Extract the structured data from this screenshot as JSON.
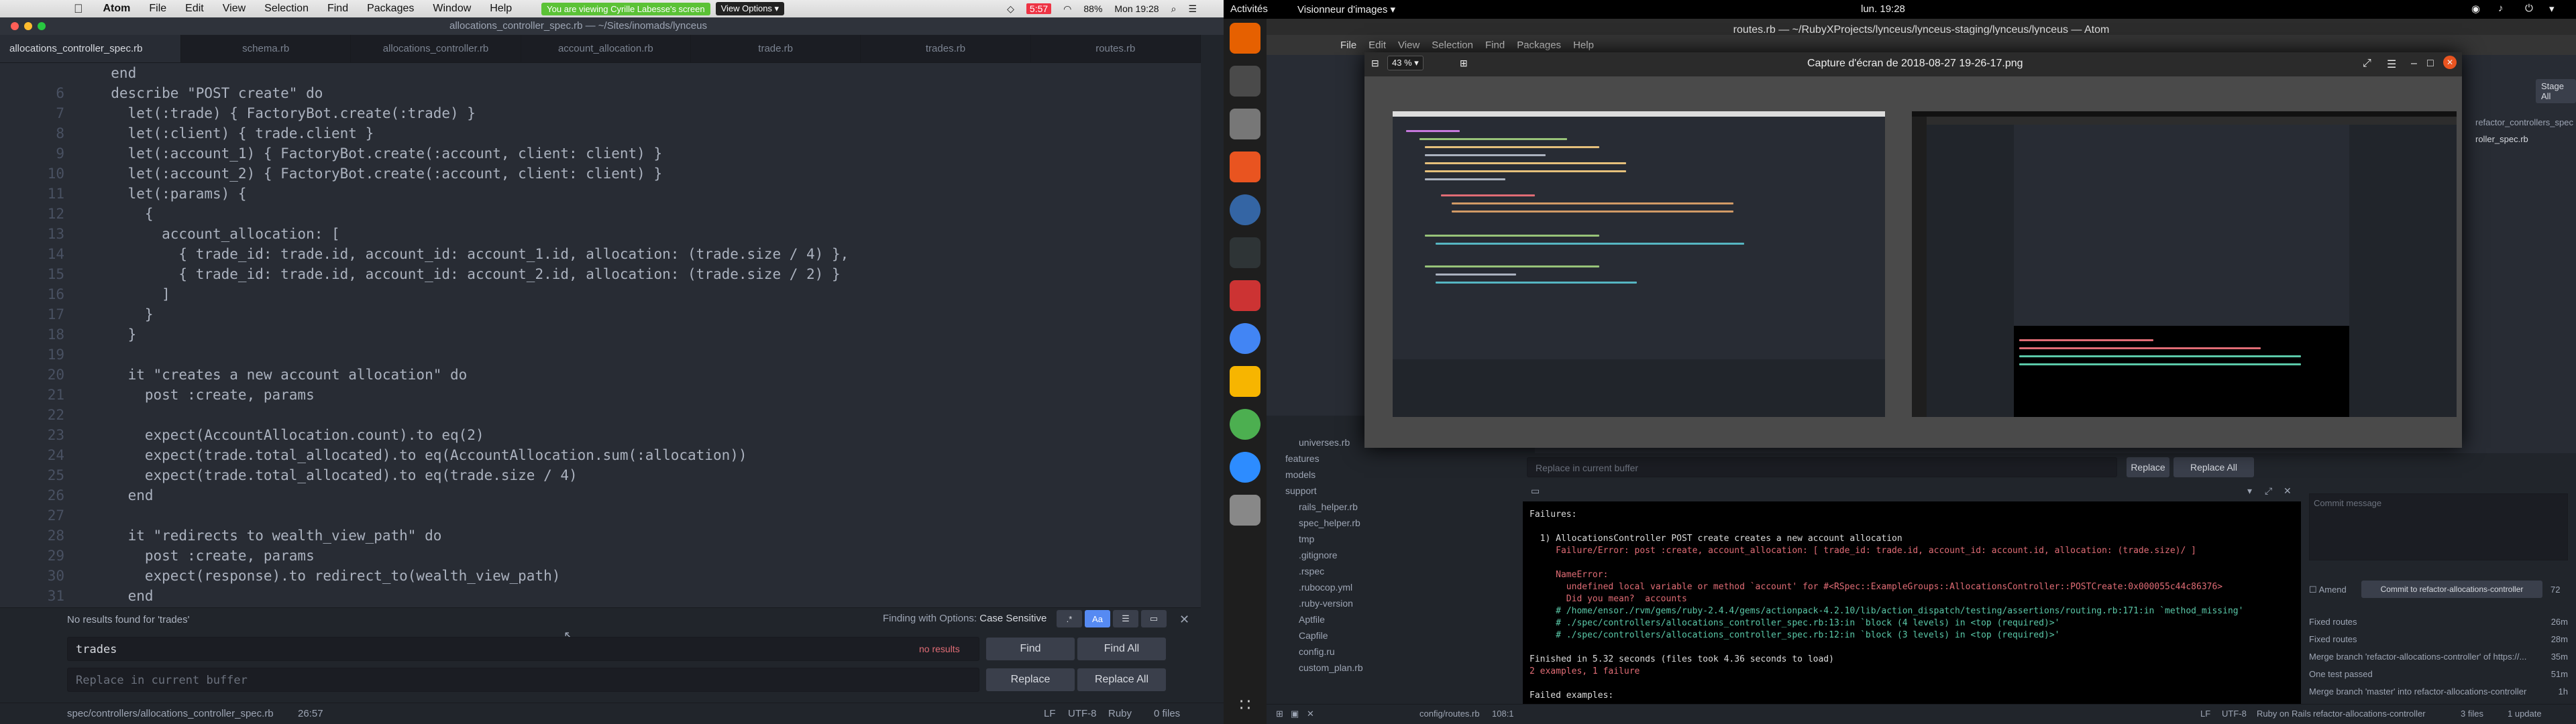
{
  "mac_menubar": {
    "apple_icon": "apple-icon",
    "items": [
      "Atom",
      "File",
      "Edit",
      "View",
      "Selection",
      "Find",
      "Packages",
      "Window",
      "Help"
    ],
    "share_notice": "You are viewing Cyrille Labesse's screen",
    "share_options": "View Options ▾",
    "window_title": "allocations_controller_spec.rb — ~/Sites/inomads/lynceus",
    "battery_time": "5:57",
    "battery_pct": "88%",
    "clock": "Mon 19:28"
  },
  "atom_left": {
    "tabs": [
      "allocations_controller_spec.rb",
      "schema.rb",
      "allocations_controller.rb",
      "account_allocation.rb",
      "trade.rb",
      "trades.rb",
      "routes.rb"
    ],
    "code_lines": [
      {
        "n": "",
        "t": "  end"
      },
      {
        "n": "6",
        "t": "  describe \"POST create\" do"
      },
      {
        "n": "7",
        "t": "    let(:trade) { FactoryBot.create(:trade) }"
      },
      {
        "n": "8",
        "t": "    let(:client) { trade.client }"
      },
      {
        "n": "9",
        "t": "    let(:account_1) { FactoryBot.create(:account, client: client) }"
      },
      {
        "n": "10",
        "t": "    let(:account_2) { FactoryBot.create(:account, client: client) }"
      },
      {
        "n": "11",
        "t": "    let(:params) {"
      },
      {
        "n": "12",
        "t": "      {"
      },
      {
        "n": "13",
        "t": "        account_allocation: ["
      },
      {
        "n": "14",
        "t": "          { trade_id: trade.id, account_id: account_1.id, allocation: (trade.size / 4) },"
      },
      {
        "n": "15",
        "t": "          { trade_id: trade.id, account_id: account_2.id, allocation: (trade.size / 2) }"
      },
      {
        "n": "16",
        "t": "        ]"
      },
      {
        "n": "17",
        "t": "      }"
      },
      {
        "n": "18",
        "t": "    }"
      },
      {
        "n": "19",
        "t": ""
      },
      {
        "n": "20",
        "t": "    it \"creates a new account allocation\" do"
      },
      {
        "n": "21",
        "t": "      post :create, params"
      },
      {
        "n": "22",
        "t": ""
      },
      {
        "n": "23",
        "t": "      expect(AccountAllocation.count).to eq(2)"
      },
      {
        "n": "24",
        "t": "      expect(trade.total_allocated).to eq(AccountAllocation.sum(:allocation))"
      },
      {
        "n": "25",
        "t": "      expect(trade.total_allocated).to eq(trade.size / 4)"
      },
      {
        "n": "26",
        "t": "    end"
      },
      {
        "n": "27",
        "t": ""
      },
      {
        "n": "28",
        "t": "    it \"redirects to wealth_view_path\" do"
      },
      {
        "n": "29",
        "t": "      post :create, params"
      },
      {
        "n": "30",
        "t": "      expect(response).to redirect_to(wealth_view_path)"
      },
      {
        "n": "31",
        "t": "    end"
      },
      {
        "n": "32",
        "t": "  end"
      }
    ],
    "find": {
      "status": "No results found for 'trades'",
      "options_label": "Finding with Options:",
      "options_value": "Case Sensitive",
      "option_buttons": [
        ".*",
        "Aa",
        "☰",
        "▭"
      ],
      "query": "trades",
      "no_results": "no results",
      "replace_placeholder": "Replace in current buffer",
      "find_btn": "Find",
      "find_all_btn": "Find All",
      "replace_btn": "Replace",
      "replace_all_btn": "Replace All"
    },
    "status": {
      "path": "spec/controllers/allocations_controller_spec.rb",
      "cursor": "26:57",
      "line_ending": "LF",
      "encoding": "UTF-8",
      "grammar": "Ruby",
      "files": "0 files"
    }
  },
  "ubuntu": {
    "activities": "Activités",
    "app_menu": "Visionneur d'images ▾",
    "clock": "lun. 19:28",
    "atom_title": "routes.rb — ~/RubyXProjects/lynceus/lynceus-staging/lynceus/lynceus — Atom",
    "atom_menu": [
      "File",
      "Edit",
      "View",
      "Selection",
      "Find",
      "Packages",
      "Help"
    ],
    "viewer": {
      "zoom": "43 %",
      "title": "Capture d'écran de 2018-08-27 19-26-17.png"
    },
    "tree_items": [
      "universes.rb",
      "features",
      "models",
      "support",
      "rails_helper.rb",
      "spec_helper.rb",
      "tmp",
      ".gitignore",
      ".rspec",
      ".rubocop.yml",
      ".ruby-version",
      "Aptfile",
      "Capfile",
      "config.ru",
      "custom_plan.rb"
    ],
    "replace_placeholder": "Replace in current buffer",
    "replace_btn": "Replace",
    "replace_all_btn": "Replace All",
    "terminal_lines": [
      "Failures:",
      "",
      "  1) AllocationsController POST create creates a new account allocation",
      "     Failure/Error: post :create, account_allocation: [ trade_id: trade.id, account_id: account.id, allocation: (trade.size)/ ]",
      "",
      "     NameError:",
      "       undefined local variable or method `account' for #<RSpec::ExampleGroups::AllocationsController::POSTCreate:0x000055c44c86376>",
      "       Did you mean?  accounts",
      "     # /home/ensor./rvm/gems/ruby-2.4.4/gems/actionpack-4.2.10/lib/action_dispatch/testing/assertions/routing.rb:171:in `method_missing'",
      "     # ./spec/controllers/allocations_controller_spec.rb:13:in `block (4 levels) in <top (required)>'",
      "     # ./spec/controllers/allocations_controller_spec.rb:12:in `block (3 levels) in <top (required)>'",
      "",
      "Finished in 5.32 seconds (files took 4.36 seconds to load)",
      "2 examples, 1 failure",
      "",
      "Failed examples:"
    ],
    "git": {
      "stage_all": "Stage All",
      "file1": "refactor_controllers_spec",
      "file2": "roller_spec.rb",
      "commit_placeholder": "Commit message",
      "amend": "Amend",
      "commit_btn": "Commit to refactor-allocations-controller",
      "commit_count": "72",
      "history": [
        {
          "msg": "Fixed routes",
          "age": "26m"
        },
        {
          "msg": "Fixed routes",
          "age": "28m"
        },
        {
          "msg": "Merge branch 'refactor-allocations-controller' of https://...",
          "age": "35m"
        },
        {
          "msg": "One test passed",
          "age": "51m"
        },
        {
          "msg": "Merge branch 'master' into refactor-allocations-controller",
          "age": "1h"
        }
      ]
    },
    "status": {
      "path": "config/routes.rb",
      "cursor": "108:1",
      "line_ending": "LF",
      "encoding": "UTF-8",
      "grammar": "Ruby on Rails",
      "branch": "refactor-allocations-controller",
      "files": "3 files",
      "updates": "1 update"
    }
  }
}
